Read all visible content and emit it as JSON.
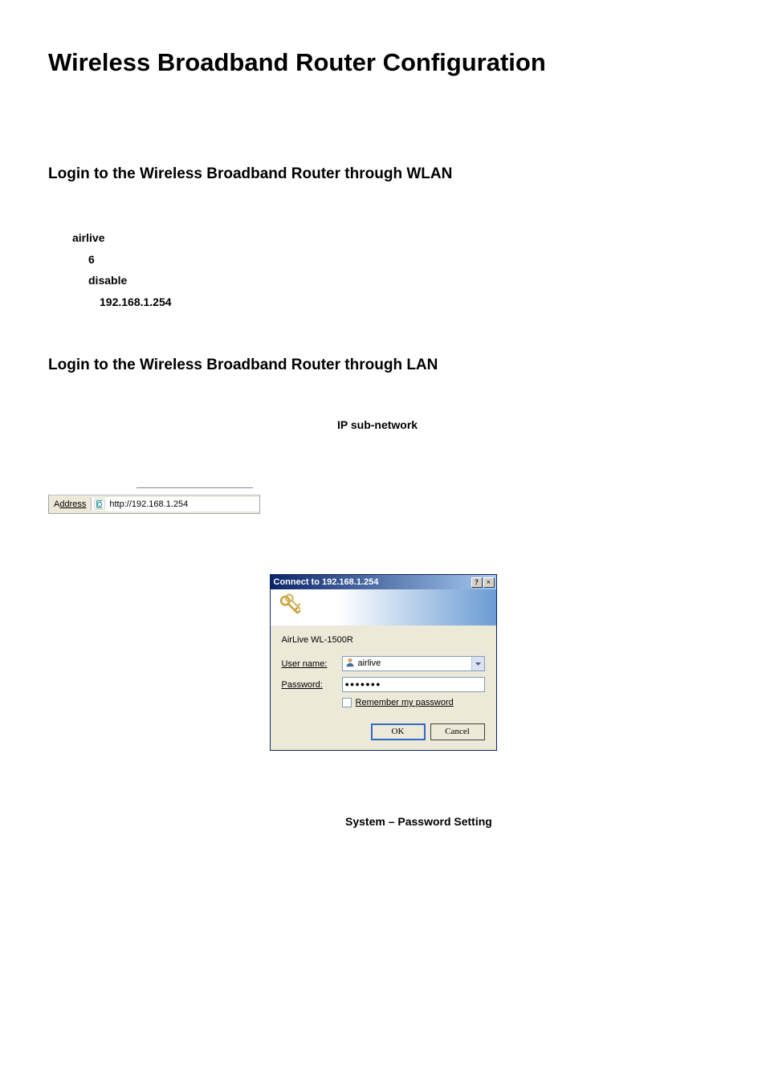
{
  "page": {
    "title": "Wireless Broadband Router Configuration",
    "section1_title": "Login to the Wireless Broadband Router through WLAN",
    "section2_title": "Login to the Wireless Broadband Router through LAN",
    "config": {
      "ssid": "airlive",
      "channel": "6",
      "wep": "disable",
      "ip": "192.168.1.254"
    },
    "ip_subnet_text": "IP sub-network",
    "footer_text": "System – Password Setting"
  },
  "addressbar": {
    "label_prefix": "A",
    "label_underlined": "d",
    "label_suffix": "dress",
    "url": "http://192.168.1.254"
  },
  "dialog": {
    "title": "Connect to 192.168.1.254",
    "help_btn": "?",
    "close_btn": "×",
    "realm": "AirLive WL-1500R",
    "username_label_u": "U",
    "username_label_rest": "ser name:",
    "username_value": "airlive",
    "password_label_u": "P",
    "password_label_rest": "assword:",
    "password_value": "●●●●●●●",
    "remember_u": "R",
    "remember_rest": "emember my password",
    "ok": "OK",
    "cancel": "Cancel"
  }
}
